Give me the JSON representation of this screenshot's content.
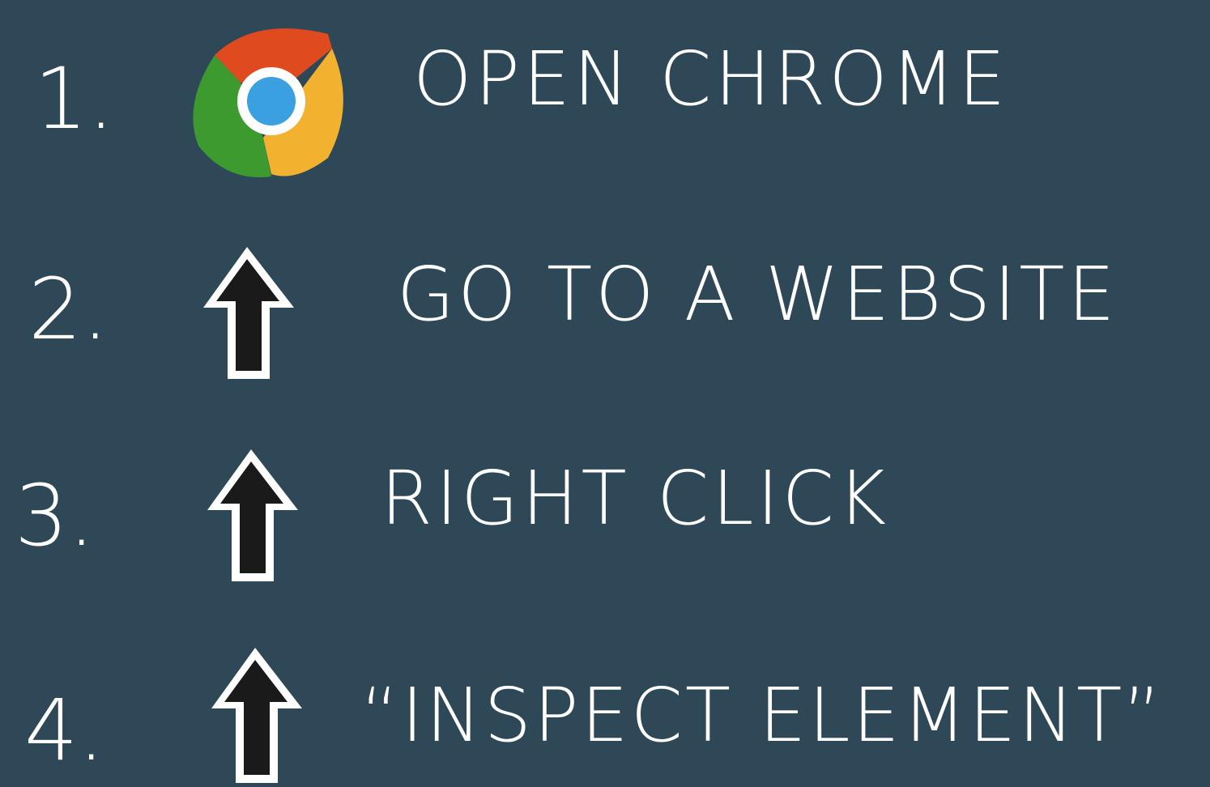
{
  "background_color": "#2f4858",
  "steps": [
    {
      "number": "1.",
      "icon": "chrome-icon",
      "text": "OPEN CHROME"
    },
    {
      "number": "2.",
      "icon": "cursor-arrow-icon",
      "text": "GO TO A WEBSITE"
    },
    {
      "number": "3.",
      "icon": "cursor-arrow-icon",
      "text": "RIGHT CLICK"
    },
    {
      "number": "4.",
      "icon": "cursor-arrow-icon",
      "text": "“INSPECT ELEMENT”"
    }
  ],
  "colors": {
    "text": "#ffffff",
    "chrome_red": "#e04a1f",
    "chrome_yellow": "#f2b230",
    "chrome_green": "#3c9a2e",
    "chrome_blue": "#3aa0e0",
    "arrow_fill": "#1a1a1a",
    "arrow_outline": "#ffffff"
  }
}
